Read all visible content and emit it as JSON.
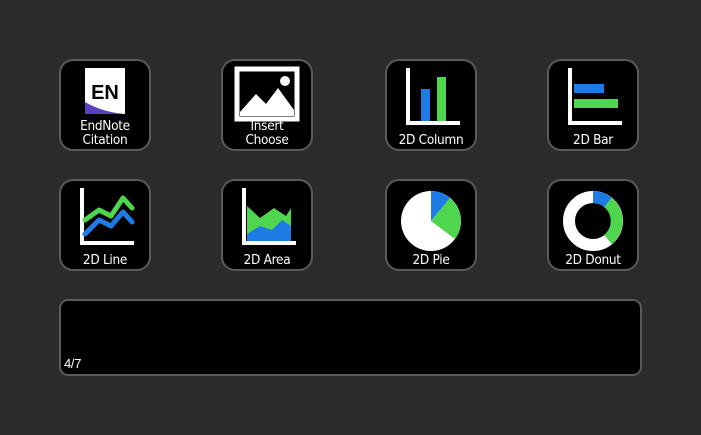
{
  "colors": {
    "background": "#2b2b2b",
    "key": "#000000",
    "border": "#5a5a5a",
    "blue": "#1e7be5",
    "green": "#4fd64f",
    "purple": "#5a3fc0"
  },
  "keys": [
    {
      "name": "endnote-citation",
      "icon": "endnote-icon",
      "icon_text": "EN",
      "label_lines": [
        "EndNote",
        "Citation"
      ]
    },
    {
      "name": "insert-choose",
      "icon": "image-icon",
      "label_lines": [
        "Insert",
        "Choose"
      ]
    },
    {
      "name": "2d-column",
      "icon": "column-chart-icon",
      "label_lines": [
        "2D Column"
      ]
    },
    {
      "name": "2d-bar",
      "icon": "bar-chart-icon",
      "label_lines": [
        "2D Bar"
      ]
    },
    {
      "name": "2d-line",
      "icon": "line-chart-icon",
      "label_lines": [
        "2D Line"
      ]
    },
    {
      "name": "2d-area",
      "icon": "area-chart-icon",
      "label_lines": [
        "2D Area"
      ]
    },
    {
      "name": "2d-pie",
      "icon": "pie-chart-icon",
      "label_lines": [
        "2D Pie"
      ]
    },
    {
      "name": "2d-donut",
      "icon": "donut-chart-icon",
      "label_lines": [
        "2D Donut"
      ]
    }
  ],
  "page_indicator": "4/7"
}
